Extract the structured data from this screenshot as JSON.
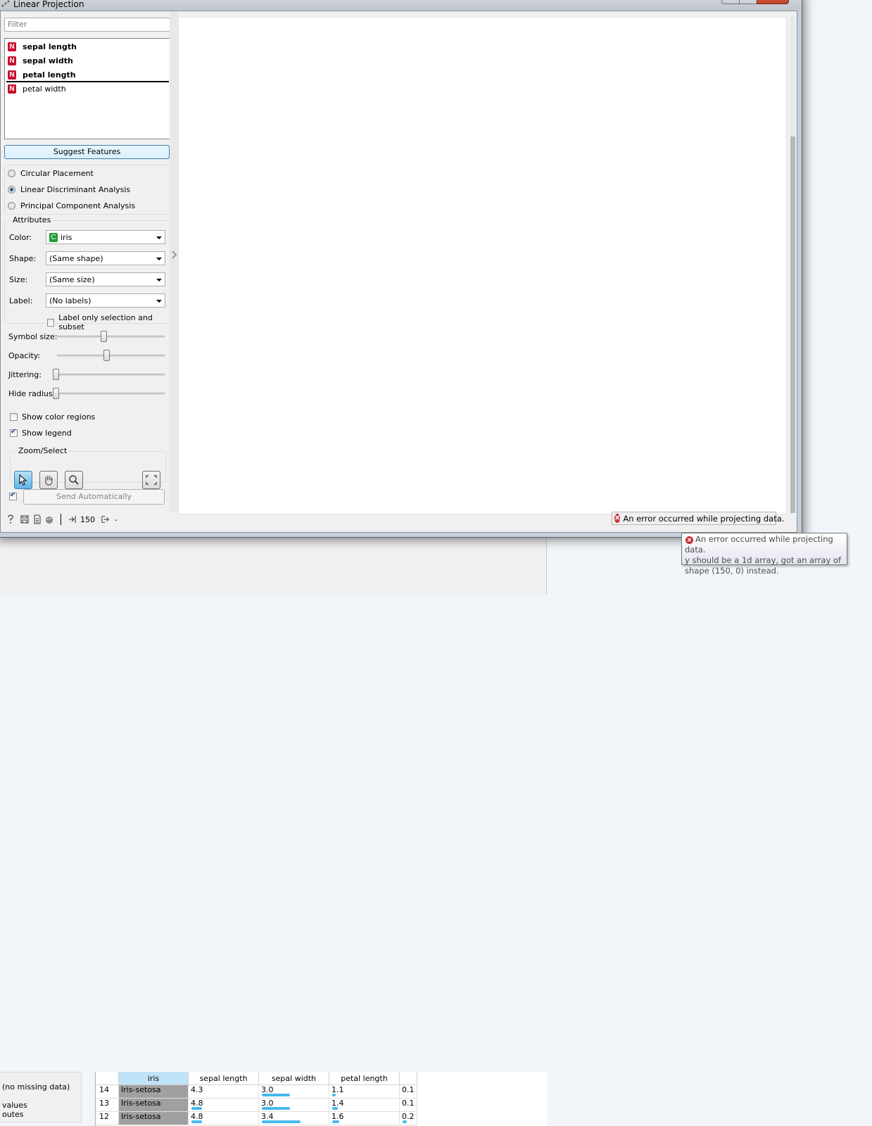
{
  "window": {
    "title": "Linear Projection"
  },
  "filter": {
    "placeholder": "Filter",
    "value": ""
  },
  "variables": [
    {
      "type_badge": "N",
      "name": "sepal length",
      "selected": true
    },
    {
      "type_badge": "N",
      "name": "sepal width",
      "selected": true
    },
    {
      "type_badge": "N",
      "name": "petal length",
      "selected": true
    },
    {
      "type_badge": "N",
      "name": "petal width",
      "selected": false
    }
  ],
  "buttons": {
    "suggest_features": "Suggest Features",
    "send_automatically": "Send Automatically"
  },
  "placement": {
    "options": [
      "Circular Placement",
      "Linear Discriminant Analysis",
      "Principal Component Analysis"
    ],
    "selected": "Linear Discriminant Analysis"
  },
  "attributes": {
    "title": "Attributes",
    "color": {
      "label": "Color:",
      "badge": "C",
      "value": "iris"
    },
    "shape": {
      "label": "Shape:",
      "value": "(Same shape)"
    },
    "size": {
      "label": "Size:",
      "value": "(Same size)"
    },
    "label": {
      "label": "Label:",
      "value": "(No labels)"
    },
    "label_only_selection": {
      "label": "Label only selection and subset",
      "checked": false
    }
  },
  "sliders": [
    {
      "label": "Symbol size:",
      "fraction": 0.47
    },
    {
      "label": "Opacity:",
      "fraction": 0.5
    },
    {
      "label": "Jittering:",
      "fraction": 0.0
    },
    {
      "label": "Hide radius:",
      "fraction": 0.0
    }
  ],
  "checkboxes": {
    "show_color_regions": {
      "label": "Show color regions",
      "checked": false
    },
    "show_legend": {
      "label": "Show legend",
      "checked": true
    },
    "send_auto": {
      "checked": true
    }
  },
  "zoom_select": {
    "title": "Zoom/Select",
    "tools": [
      "pointer-select",
      "pan",
      "zoom",
      "reset-zoom"
    ],
    "active": "pointer-select"
  },
  "statusbar": {
    "input_count": "150",
    "output_count": "-"
  },
  "error": {
    "message": "An error occurred while projecting data.",
    "tooltip_line1": "An error occurred while projecting data.",
    "tooltip_line2": "y should be a 1d array, got an array of",
    "tooltip_line3": "shape (150, 0) instead."
  },
  "background_table": {
    "info_lines": [
      "(no missing data)",
      "values",
      "outes"
    ],
    "headers": [
      "",
      "iris",
      "sepal length",
      "sepal width",
      "petal length",
      ""
    ],
    "rows": [
      {
        "index": "14",
        "iris": "Iris-setosa",
        "sepal_length": "4.3",
        "sepal_width": "3.0",
        "petal_length": "1.1",
        "petal_width": "0.1"
      },
      {
        "index": "13",
        "iris": "Iris-setosa",
        "sepal_length": "4.8",
        "sepal_width": "3.0",
        "petal_length": "1.4",
        "petal_width": "0.1"
      },
      {
        "index": "12",
        "iris": "Iris-setosa",
        "sepal_length": "4.8",
        "sepal_width": "3.4",
        "petal_length": "1.6",
        "petal_width": "0.2"
      }
    ]
  },
  "colors": {
    "accent": "#3c7fb1",
    "numeric_badge": "#c8102e",
    "categorical_badge": "#1f9c3b",
    "bar": "#45b9ee",
    "error": "#c1272d"
  }
}
